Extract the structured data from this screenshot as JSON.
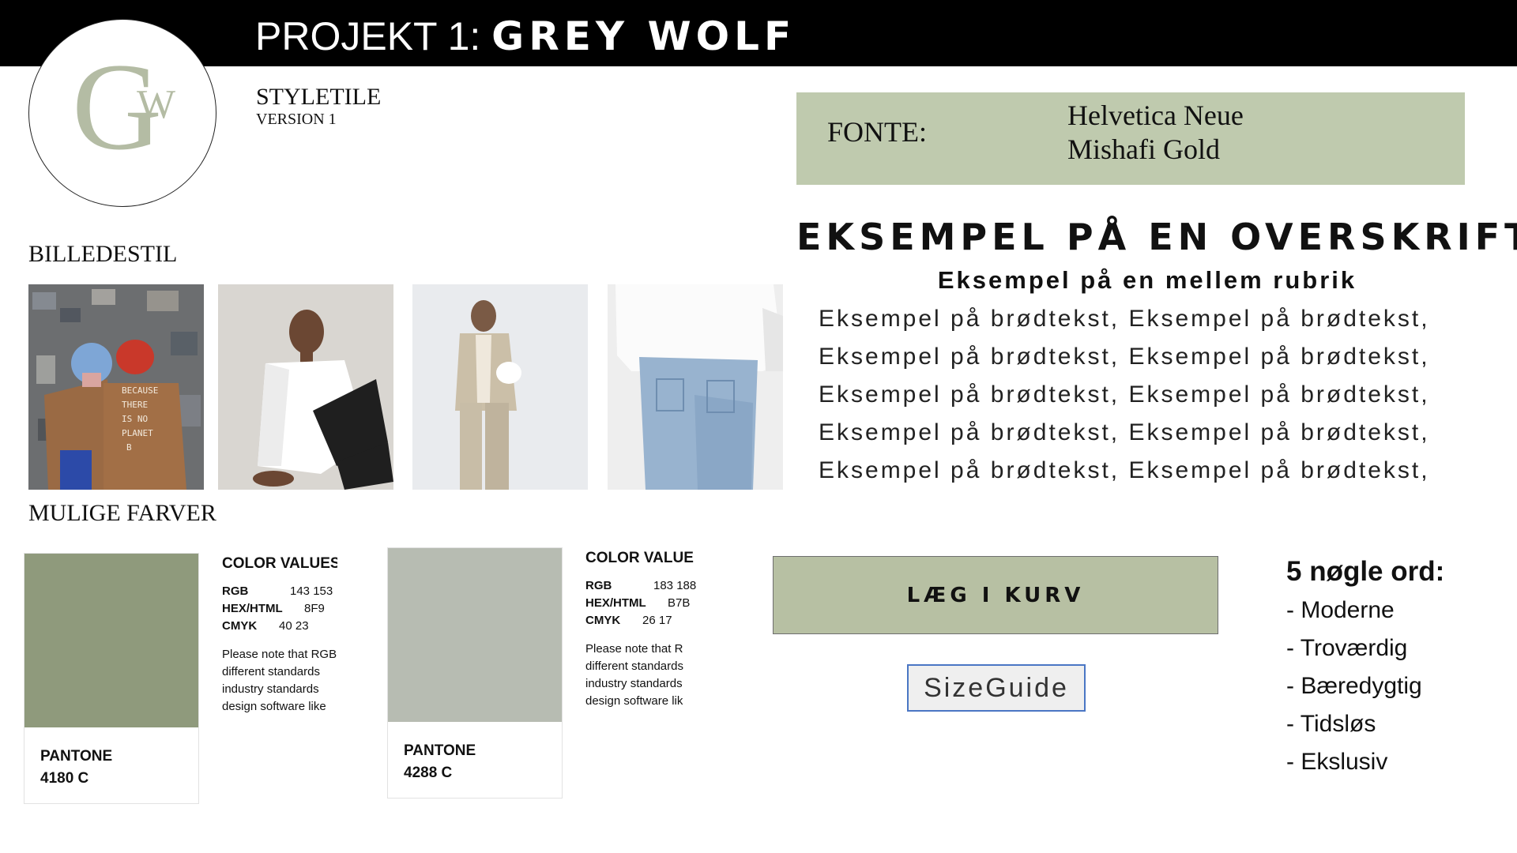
{
  "header": {
    "title_prefix": "PROJEKT 1: ",
    "title_name": "GREY WOLF"
  },
  "logo": {
    "letter_main": "G",
    "letter_small": "W",
    "color": "#b4bca4"
  },
  "styletile": {
    "label": "STYLETILE",
    "version": "VERSION 1"
  },
  "fonts": {
    "label": "FONTE:",
    "names": [
      "Helvetica Neue",
      "Mishafi Gold"
    ],
    "box_color": "#bfcaae"
  },
  "typography": {
    "heading": "EKSEMPEL PÅ EN OVERSKRIFT",
    "subheading": "Eksempel på en mellem rubrik",
    "body_lines": [
      "Eksempel på brødtekst, Eksempel på brødtekst,",
      "Eksempel på brødtekst, Eksempel på brødtekst,",
      "Eksempel på brødtekst, Eksempel på brødtekst,",
      "Eksempel på brødtekst, Eksempel på brødtekst,",
      "Eksempel på brødtekst, Eksempel på brødtekst,"
    ]
  },
  "image_style": {
    "label": "BILLEDESTIL",
    "jacket_text": [
      "BECAUSE",
      "THERE",
      "IS NO",
      "PLANET",
      "B"
    ]
  },
  "colors": {
    "label": "MULIGE FARVER",
    "swatches": [
      {
        "hex": "#8f9a7c",
        "pantone_label": "PANTONE",
        "pantone_code": "4180 C",
        "values_title": "COLOR VALUES",
        "rgb_label": "RGB",
        "rgb": "143   153",
        "hex_label": "HEX/HTML",
        "hex_value": "8F9",
        "cmyk_label": "CMYK",
        "cmyk": "40   23",
        "note": [
          "Please note that RGB",
          "different standards",
          "industry standards",
          "design software like"
        ]
      },
      {
        "hex": "#b7bcb2",
        "pantone_label": "PANTONE",
        "pantone_code": "4288 C",
        "values_title": "COLOR VALUE",
        "rgb_label": "RGB",
        "rgb": "183   188",
        "hex_label": "HEX/HTML",
        "hex_value": "B7B",
        "cmyk_label": "CMYK",
        "cmyk": "26   17",
        "note": [
          "Please note that R",
          "different standards",
          "industry standards",
          "design software lik"
        ]
      }
    ]
  },
  "buttons": {
    "cart": "LÆG I KURV",
    "cart_color": "#b7c0a3",
    "size_guide": "SizeGuide",
    "size_guide_border": "#4a76c4"
  },
  "keywords": {
    "title": "5 nøgle ord:",
    "items": [
      "- Moderne",
      "- Troværdig",
      "- Bæredygtig",
      "- Tidsløs",
      "- Ekslusiv"
    ]
  }
}
